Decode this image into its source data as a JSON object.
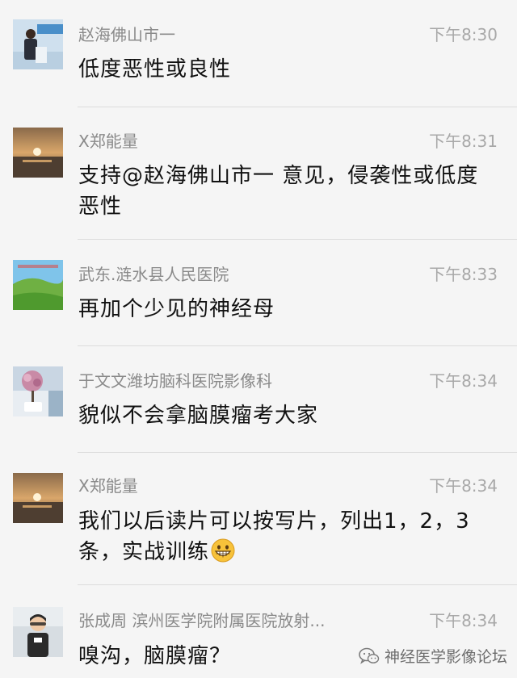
{
  "messages": [
    {
      "name": "赵海佛山市一",
      "time": "下午8:30",
      "text_lines": [
        "低度恶性或良性"
      ],
      "avatar_icon": "speaker-photo-avatar"
    },
    {
      "name": "X郑能量",
      "time": "下午8:31",
      "text_lines": [
        "支持@赵海佛山市一 意见，侵袭性或低度",
        "恶性"
      ],
      "avatar_icon": "sunset-photo-avatar"
    },
    {
      "name": "武东.涟水县人民医院",
      "time": "下午8:33",
      "text_lines": [
        "再加个少见的神经母"
      ],
      "avatar_icon": "landscape-photo-avatar"
    },
    {
      "name": "于文文潍坊脑科医院影像科",
      "time": "下午8:34",
      "text_lines": [
        "貌似不会拿脑膜瘤考大家"
      ],
      "avatar_icon": "flower-tree-photo-avatar"
    },
    {
      "name": "X郑能量",
      "time": "下午8:34",
      "text_lines": [
        "我们以后读片可以按写片，列出1，2，3",
        "条，实战训练"
      ],
      "avatar_icon": "sunset-photo-avatar",
      "trailing_emoji": "grinning-face-icon"
    },
    {
      "name": "张成周 滨州医学院附属医院放射...",
      "time": "下午8:34",
      "text_lines": [
        "嗅沟，脑膜瘤？"
      ],
      "avatar_icon": "child-photo-avatar"
    }
  ],
  "watermark": {
    "label": "神经医学影像论坛",
    "icon": "wechat-icon"
  },
  "colors": {
    "background": "#f5f5f5",
    "name_text": "#8a8a8a",
    "time_text": "#a8a8a8",
    "message_text": "#111111",
    "divider": "#dcdcdc"
  }
}
